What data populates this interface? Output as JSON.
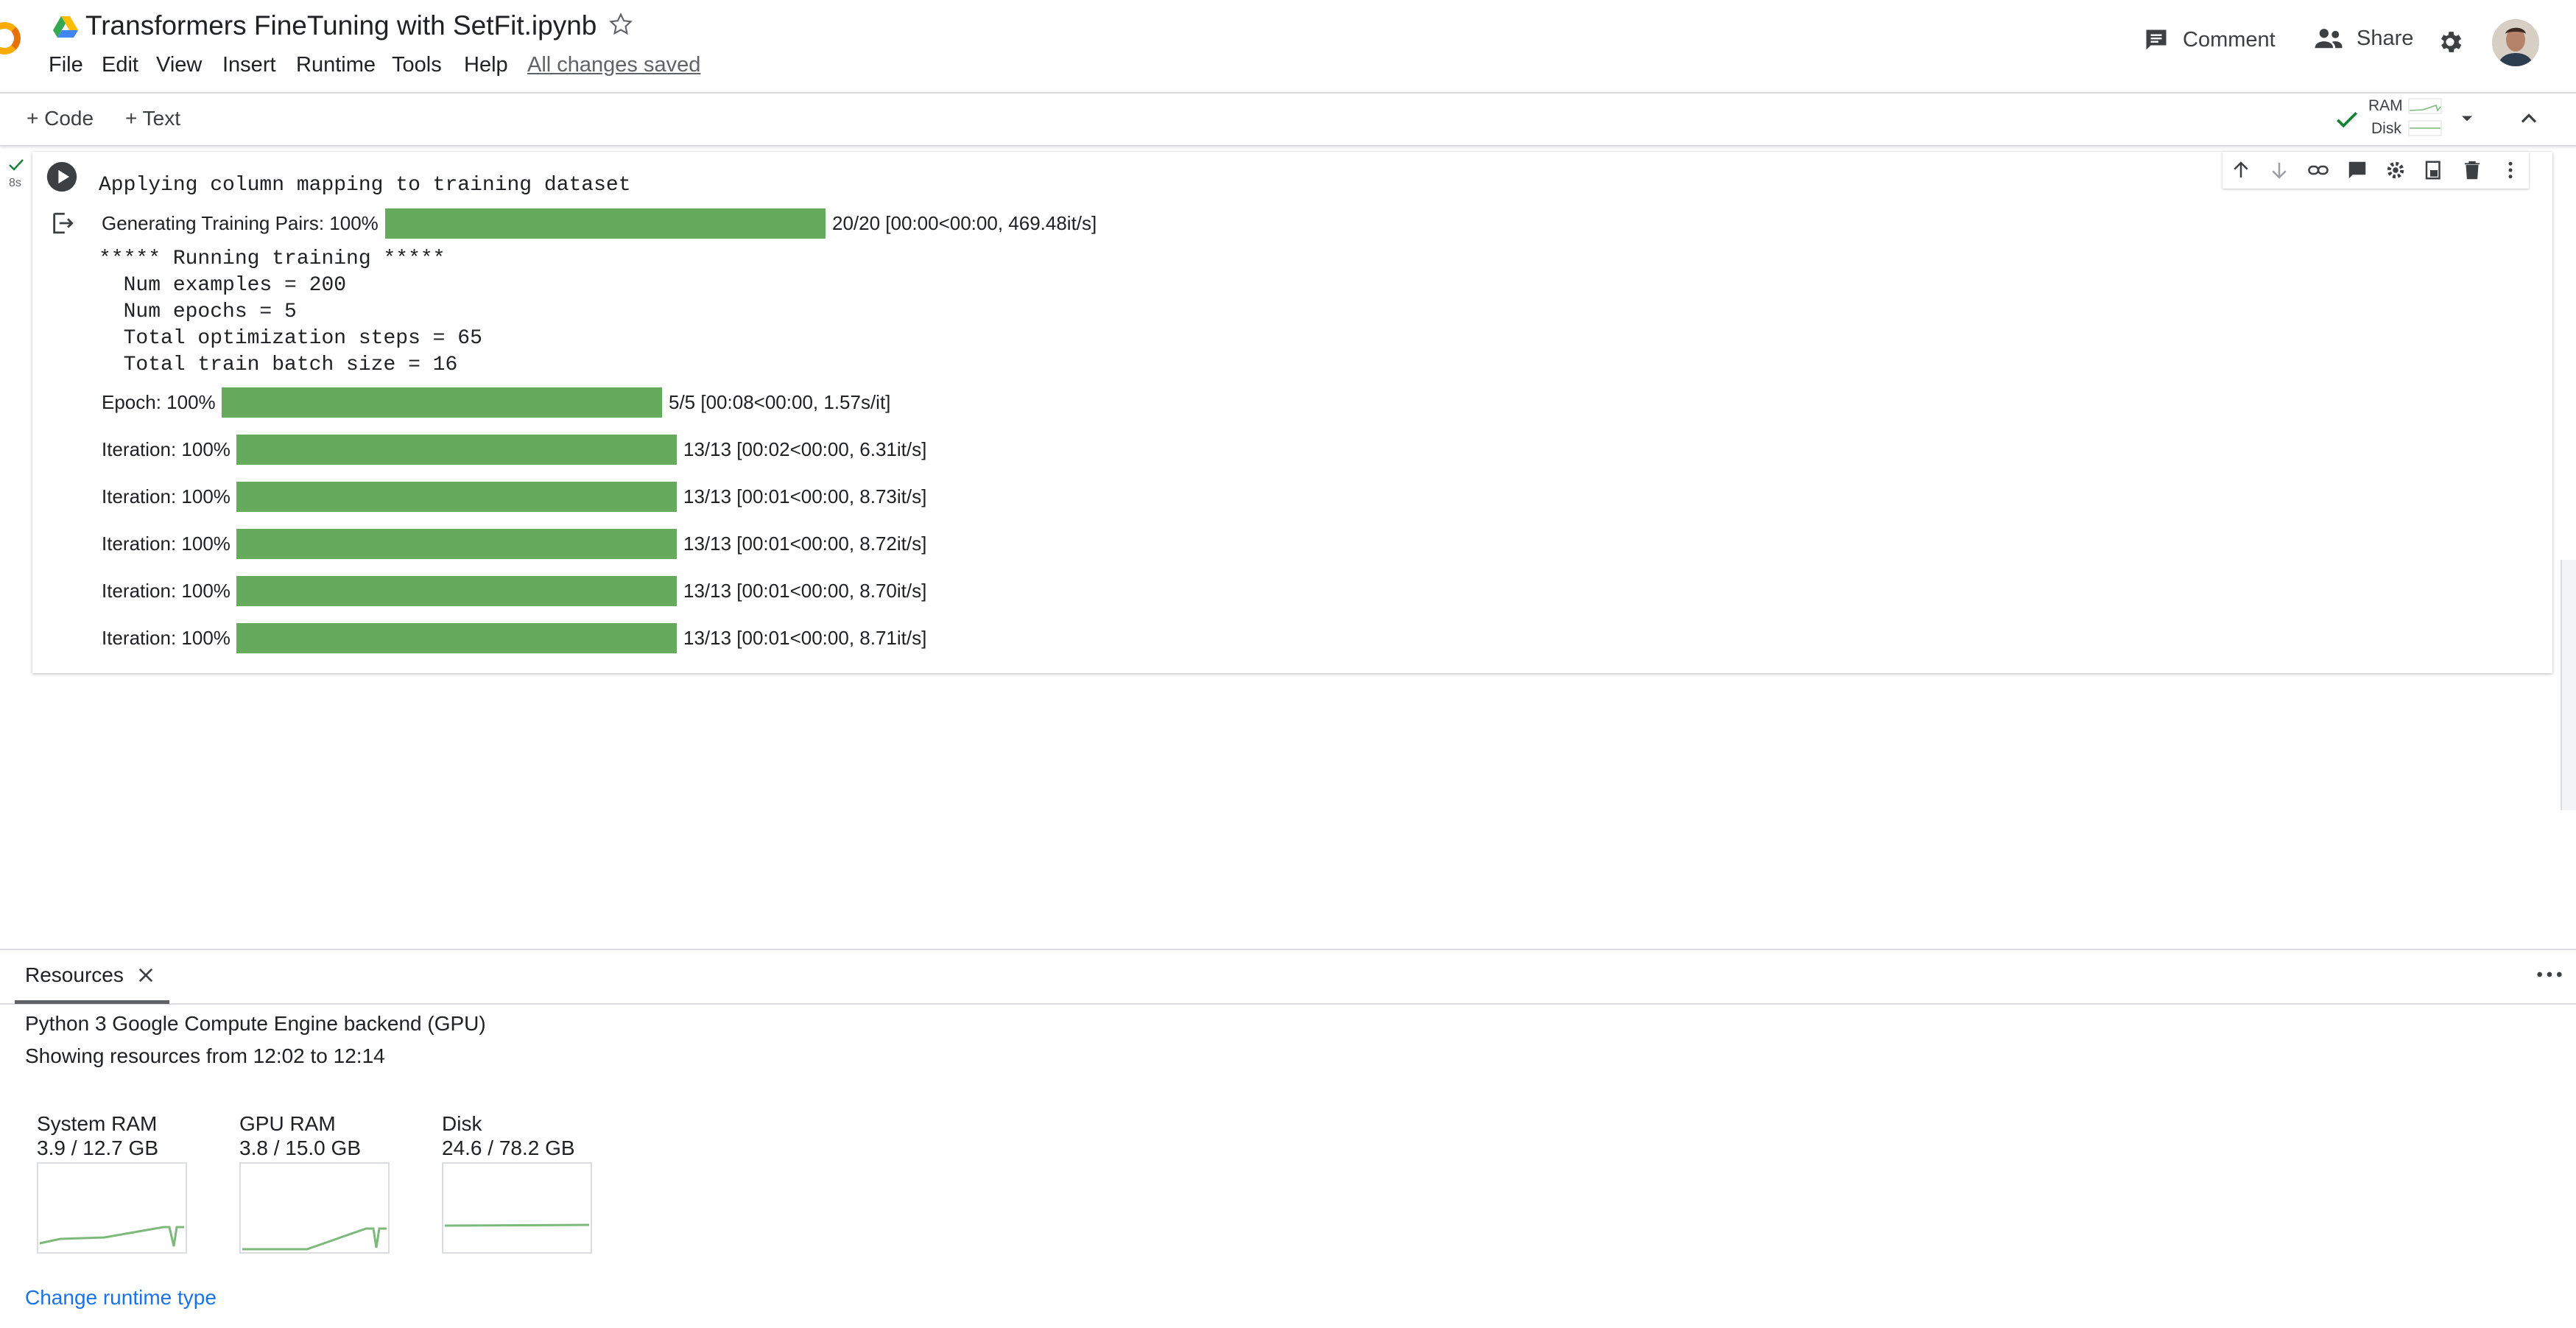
{
  "header": {
    "title": "Transformers FineTuning with SetFit.ipynb",
    "menu": [
      "File",
      "Edit",
      "View",
      "Insert",
      "Runtime",
      "Tools",
      "Help"
    ],
    "save_status": "All changes saved",
    "comment_label": "Comment",
    "share_label": "Share"
  },
  "toolbar": {
    "add_code_label": "+ Code",
    "add_text_label": "+ Text",
    "ram_label": "RAM",
    "disk_label": "Disk"
  },
  "cell": {
    "exec_time": "8s",
    "lines": {
      "applying": "Applying column mapping to training dataset",
      "running": "***** Running training *****",
      "num_examples": "  Num examples = 200",
      "num_epochs": "  Num epochs = 5",
      "total_steps": "  Total optimization steps = 65",
      "batch_size": "  Total train batch size = 16"
    },
    "progress": [
      {
        "label": "Generating Training Pairs: 100%",
        "status": "20/20 [00:00<00:00, 469.48it/s]",
        "fraction": 1.0
      },
      {
        "label": "Epoch: 100%",
        "status": "5/5 [00:08<00:00, 1.57s/it]",
        "fraction": 1.0
      },
      {
        "label": "Iteration: 100%",
        "status": "13/13 [00:02<00:00, 6.31it/s]",
        "fraction": 1.0
      },
      {
        "label": "Iteration: 100%",
        "status": "13/13 [00:01<00:00, 8.73it/s]",
        "fraction": 1.0
      },
      {
        "label": "Iteration: 100%",
        "status": "13/13 [00:01<00:00, 8.72it/s]",
        "fraction": 1.0
      },
      {
        "label": "Iteration: 100%",
        "status": "13/13 [00:01<00:00, 8.70it/s]",
        "fraction": 1.0
      },
      {
        "label": "Iteration: 100%",
        "status": "13/13 [00:01<00:00, 8.71it/s]",
        "fraction": 1.0
      }
    ]
  },
  "resources": {
    "tab_label": "Resources",
    "backend": "Python 3 Google Compute Engine backend (GPU)",
    "range": "Showing resources from 12:02 to 12:14",
    "metrics": [
      {
        "name": "System RAM",
        "value": "3.9 / 12.7 GB"
      },
      {
        "name": "GPU RAM",
        "value": "3.8 / 15.0 GB"
      },
      {
        "name": "Disk",
        "value": "24.6 / 78.2 GB"
      }
    ],
    "change_runtime": "Change runtime type"
  },
  "colors": {
    "progress_fill": "#66aa5e",
    "link": "#1a73e8",
    "sparkline": "#7cb97a"
  }
}
